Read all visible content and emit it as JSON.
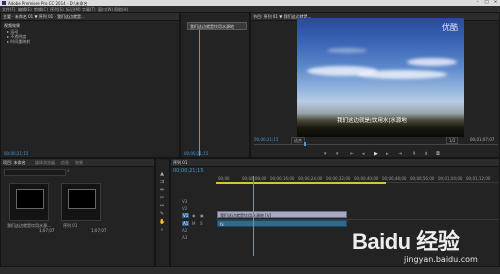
{
  "window": {
    "title": "Adobe Premiere Pro CC 2014 - D:\\未命名",
    "controls": [
      "–",
      "□",
      "×"
    ]
  },
  "menu": {
    "items": [
      "文件(F)",
      "编辑(E)",
      "剪辑(C)",
      "序列(S)",
      "标记(M)",
      "字幕(T)",
      "窗口(W)",
      "帮助(H)"
    ]
  },
  "effects_panel": {
    "header": "主要 · 未命名 01 ▼ 序列 01 · 我们这边就是...",
    "section": "视频效果",
    "rows": [
      "运动",
      "不透明度",
      "时间重映射"
    ],
    "timecode": "00;00;21;15"
  },
  "source_panel": {
    "clip_label": "我们这边就是饮用水源地",
    "timecode": "00;00;21;15"
  },
  "program_monitor": {
    "header": "节目: 序列 01 ▼ 我们这边就是...",
    "watermark": "优酷",
    "subtitle": "我们这边就是|饮用水|水源地",
    "timecode_left": "00;00;21;15",
    "timecode_right": "00;01;07;07",
    "zoom": "适合",
    "quality": "1/2"
  },
  "project_panel": {
    "tabs": [
      "项目: 未命名",
      "媒体浏览器",
      "信息",
      "效果"
    ],
    "search_placeholder": "",
    "items": [
      {
        "name": "我们这边就是饮用水源...",
        "duration": "1;07;07"
      },
      {
        "name": "序列 01",
        "duration": "1;07;07"
      }
    ],
    "status": "项目: 未命名  2 项"
  },
  "timeline": {
    "tab": "序列 01",
    "timecode": "00;00;21;15",
    "ruler": [
      "00;00",
      "00;00;08;00",
      "00;00;16;00",
      "00;00;24;00",
      "00;00;32;00",
      "00;00;40;00",
      "00;00;48;00",
      "00;00;56;00",
      "00;01;04;00",
      "00;01;12;00"
    ],
    "tracks": [
      "V3",
      "V2",
      "V1",
      "A1",
      "A2",
      "A3"
    ],
    "clip_label": "我们这边就是饮用水源地 [V]",
    "clip_fx": "fx"
  },
  "branding": {
    "text": "Baidu 经验",
    "url": "jingyan.baidu.com"
  },
  "colors": {
    "accent_blue": "#3f9ad8",
    "panel_bg": "#232323",
    "playhead": "#4a9ede"
  }
}
